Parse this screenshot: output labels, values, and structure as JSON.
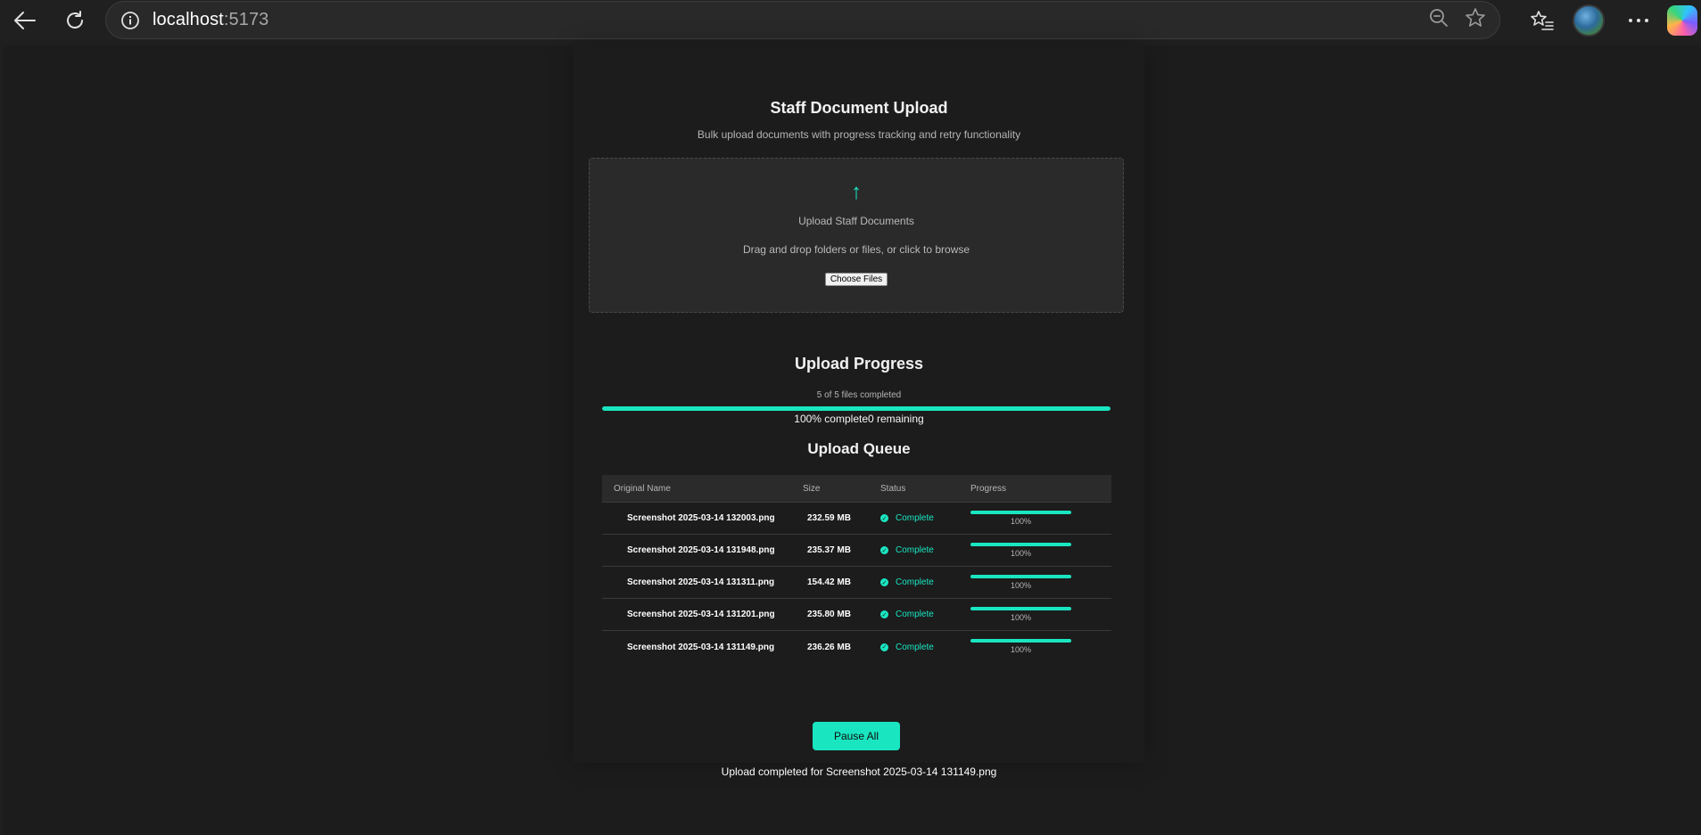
{
  "browser": {
    "url_host": "localhost",
    "url_port": ":5173"
  },
  "page": {
    "title": "Staff Document Upload",
    "subtitle": "Bulk upload documents with progress tracking and retry functionality"
  },
  "dropzone": {
    "icon": "arrow-up-icon",
    "arrow_glyph": "↑",
    "title": "Upload Staff Documents",
    "instructions": "Drag and drop folders or files, or click to browse",
    "button_label": "Choose Files"
  },
  "overall_progress": {
    "heading": "Upload Progress",
    "files_text": "5 of 5 files completed",
    "percent": 100,
    "stats_text": "100% complete0 remaining"
  },
  "queue": {
    "heading": "Upload Queue",
    "columns": [
      "Original Name",
      "Size",
      "Status",
      "Progress"
    ],
    "rows": [
      {
        "name": "Screenshot 2025-03-14 132003.png",
        "size": "232.59 MB",
        "status": "Complete",
        "progress": 100,
        "progress_label": "100%"
      },
      {
        "name": "Screenshot 2025-03-14 131948.png",
        "size": "235.37 MB",
        "status": "Complete",
        "progress": 100,
        "progress_label": "100%"
      },
      {
        "name": "Screenshot 2025-03-14 131311.png",
        "size": "154.42 MB",
        "status": "Complete",
        "progress": 100,
        "progress_label": "100%"
      },
      {
        "name": "Screenshot 2025-03-14 131201.png",
        "size": "235.80 MB",
        "status": "Complete",
        "progress": 100,
        "progress_label": "100%"
      },
      {
        "name": "Screenshot 2025-03-14 131149.png",
        "size": "236.26 MB",
        "status": "Complete",
        "progress": 100,
        "progress_label": "100%"
      }
    ]
  },
  "actions": {
    "pause_label": "Pause All"
  },
  "notification": {
    "text": "Upload completed for Screenshot 2025-03-14 131149.png"
  },
  "colors": {
    "accent": "#19e6c1",
    "background": "#1c1c1c",
    "panel": "#2a2a2a"
  }
}
